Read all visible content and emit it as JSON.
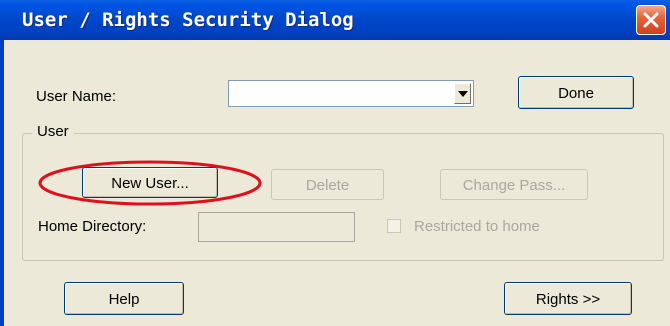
{
  "window": {
    "title": "User / Rights Security Dialog",
    "icons": {
      "close": "close-icon",
      "dropdown": "chevron-down-icon"
    },
    "colors": {
      "titlebar": "#0047C8",
      "close": "#D0401A",
      "annotation": "#E0101A",
      "face": "#ECE9D8"
    }
  },
  "form": {
    "user_name_label": "User Name:",
    "user_name_value": "",
    "done_label": "Done"
  },
  "user_group": {
    "legend": "User",
    "new_user_label": "New User...",
    "delete_label": "Delete",
    "change_pass_label": "Change Pass...",
    "home_directory_label": "Home Directory:",
    "home_directory_value": "",
    "restricted_label": "Restricted to home",
    "restricted_checked": false
  },
  "footer": {
    "help_label": "Help",
    "rights_label": "Rights >>"
  }
}
